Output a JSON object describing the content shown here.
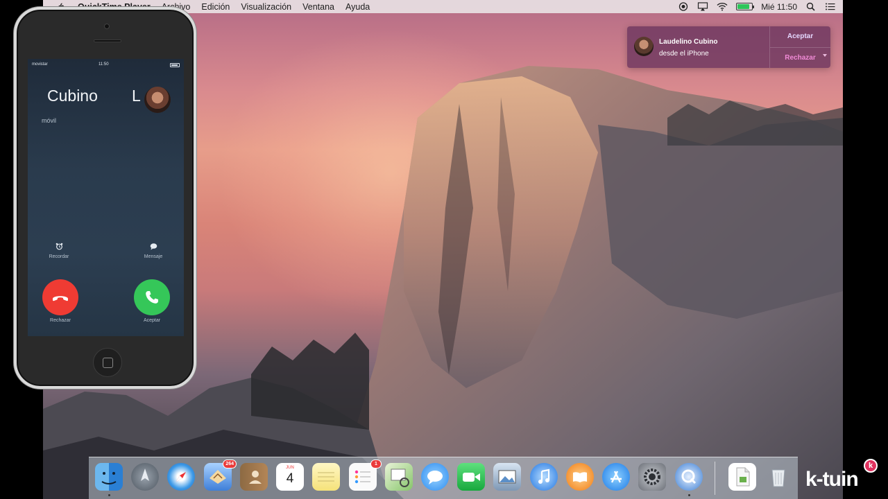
{
  "menubar": {
    "app_name": "QuickTime Player",
    "menus": [
      "Archivo",
      "Edición",
      "Visualización",
      "Ventana",
      "Ayuda"
    ],
    "clock": "Mié 11:50",
    "status_icons": [
      "record-icon",
      "airplay-icon",
      "wifi-icon",
      "battery-icon",
      "spotlight-icon",
      "notification-center-icon"
    ]
  },
  "notification": {
    "caller": "Laudelino Cubino",
    "detail": "desde el iPhone",
    "accept_label": "Aceptar",
    "reject_label": "Rechazar"
  },
  "iphone": {
    "carrier": "movistar",
    "time": "11:50",
    "caller_name": "Cubino",
    "caller_initial": "L",
    "subtitle": "móvil",
    "remind_label": "Recordar",
    "message_label": "Mensaje",
    "decline_label": "Rechazar",
    "accept_label": "Aceptar"
  },
  "dock": {
    "items": [
      {
        "name": "finder",
        "badge": ""
      },
      {
        "name": "launchpad",
        "badge": ""
      },
      {
        "name": "safari",
        "badge": ""
      },
      {
        "name": "mail",
        "badge": "264"
      },
      {
        "name": "contacts",
        "badge": ""
      },
      {
        "name": "calendar",
        "badge": "",
        "month": "JUN",
        "day": "4"
      },
      {
        "name": "notes",
        "badge": ""
      },
      {
        "name": "reminders",
        "badge": "1"
      },
      {
        "name": "preview",
        "badge": ""
      },
      {
        "name": "messages",
        "badge": ""
      },
      {
        "name": "facetime",
        "badge": ""
      },
      {
        "name": "photos",
        "badge": ""
      },
      {
        "name": "itunes",
        "badge": ""
      },
      {
        "name": "ibooks",
        "badge": ""
      },
      {
        "name": "app-store",
        "badge": ""
      },
      {
        "name": "system-preferences",
        "badge": ""
      },
      {
        "name": "quicktime",
        "badge": ""
      },
      {
        "name": "document",
        "badge": ""
      },
      {
        "name": "trash",
        "badge": ""
      }
    ]
  },
  "watermark": {
    "text": "k-tuin",
    "badge": "k"
  },
  "colors": {
    "decline": "#ef3b33",
    "accept": "#35c759",
    "notification_bg": "#6e375f",
    "notification_reject": "#f08ad6"
  }
}
